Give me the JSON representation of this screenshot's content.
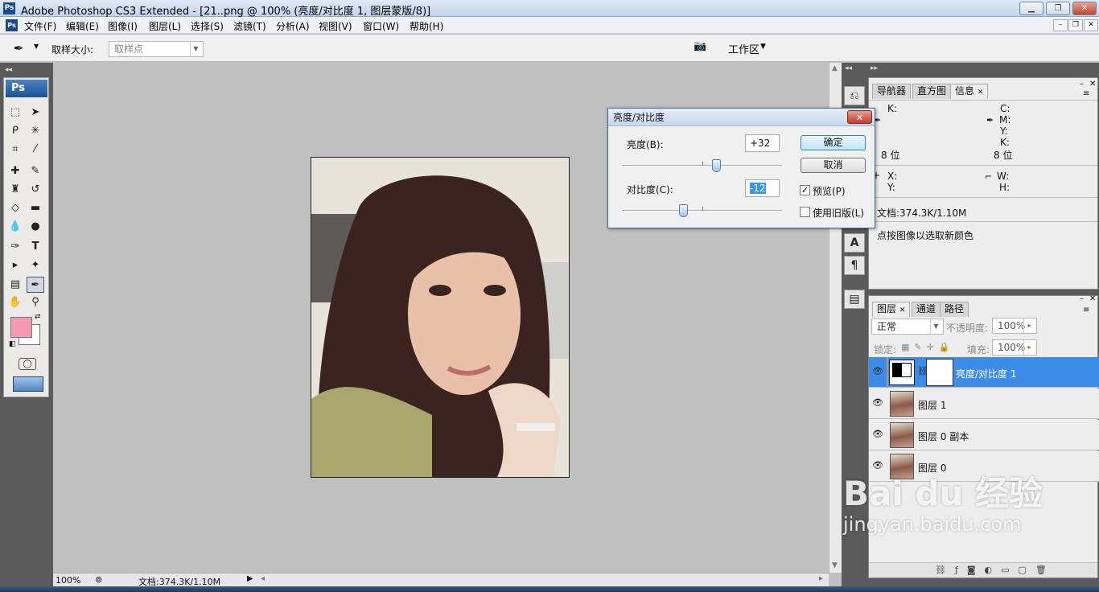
{
  "window": {
    "title": "Adobe Photoshop CS3 Extended - [21..png @ 100% (亮度/对比度 1, 图层蒙版/8)]",
    "app_icon": "Ps"
  },
  "menu": [
    "文件(F)",
    "编辑(E)",
    "图像(I)",
    "图层(L)",
    "选择(S)",
    "滤镜(T)",
    "分析(A)",
    "视图(V)",
    "窗口(W)",
    "帮助(H)"
  ],
  "options": {
    "sample_size_label": "取样大小:",
    "sample_size_value": "取样点",
    "workspace_label": "工作区"
  },
  "tools": {
    "logo": "Ps"
  },
  "status": {
    "zoom": "100%",
    "doc": "文档:374.3K/1.10M"
  },
  "info_panel": {
    "tabs": [
      "导航器",
      "直方图",
      "信息"
    ],
    "k_left": "K:",
    "c_right": "C:",
    "m_right": "M:",
    "y_right": "Y:",
    "k_right": "K:",
    "bits_left": "8 位",
    "bits_right": "8 位",
    "x": "X:",
    "y": "Y:",
    "w": "W:",
    "h": "H:",
    "doc": "文档:374.3K/1.10M",
    "hint": "点按图像以选取新颜色"
  },
  "layers_panel": {
    "tabs": [
      "图层",
      "通道",
      "路径"
    ],
    "blend_mode": "正常",
    "opacity_label": "不透明度:",
    "opacity_value": "100%",
    "lock_label": "锁定:",
    "fill_label": "填充:",
    "fill_value": "100%",
    "layers": [
      {
        "name": "亮度/对比度 1",
        "selected": true
      },
      {
        "name": "图层 1",
        "selected": false
      },
      {
        "name": "图层 0 副本",
        "selected": false
      },
      {
        "name": "图层 0",
        "selected": false
      }
    ]
  },
  "dialog": {
    "title": "亮度/对比度",
    "brightness_label": "亮度(B):",
    "brightness_value": "+32",
    "contrast_label": "对比度(C):",
    "contrast_value": "-12",
    "ok": "确定",
    "cancel": "取消",
    "preview_label": "预览(P)",
    "preview_checked": true,
    "legacy_label": "使用旧版(L)",
    "legacy_checked": false,
    "brightness_slider_fraction": 0.59,
    "contrast_slider_fraction": 0.38
  },
  "watermark": {
    "brand": "Bai du 经验",
    "url": "jingyan.baidu.com"
  },
  "colors": {
    "foreground": "#f59ab5",
    "background": "#ffffff",
    "selection": "#3d8ce8"
  }
}
